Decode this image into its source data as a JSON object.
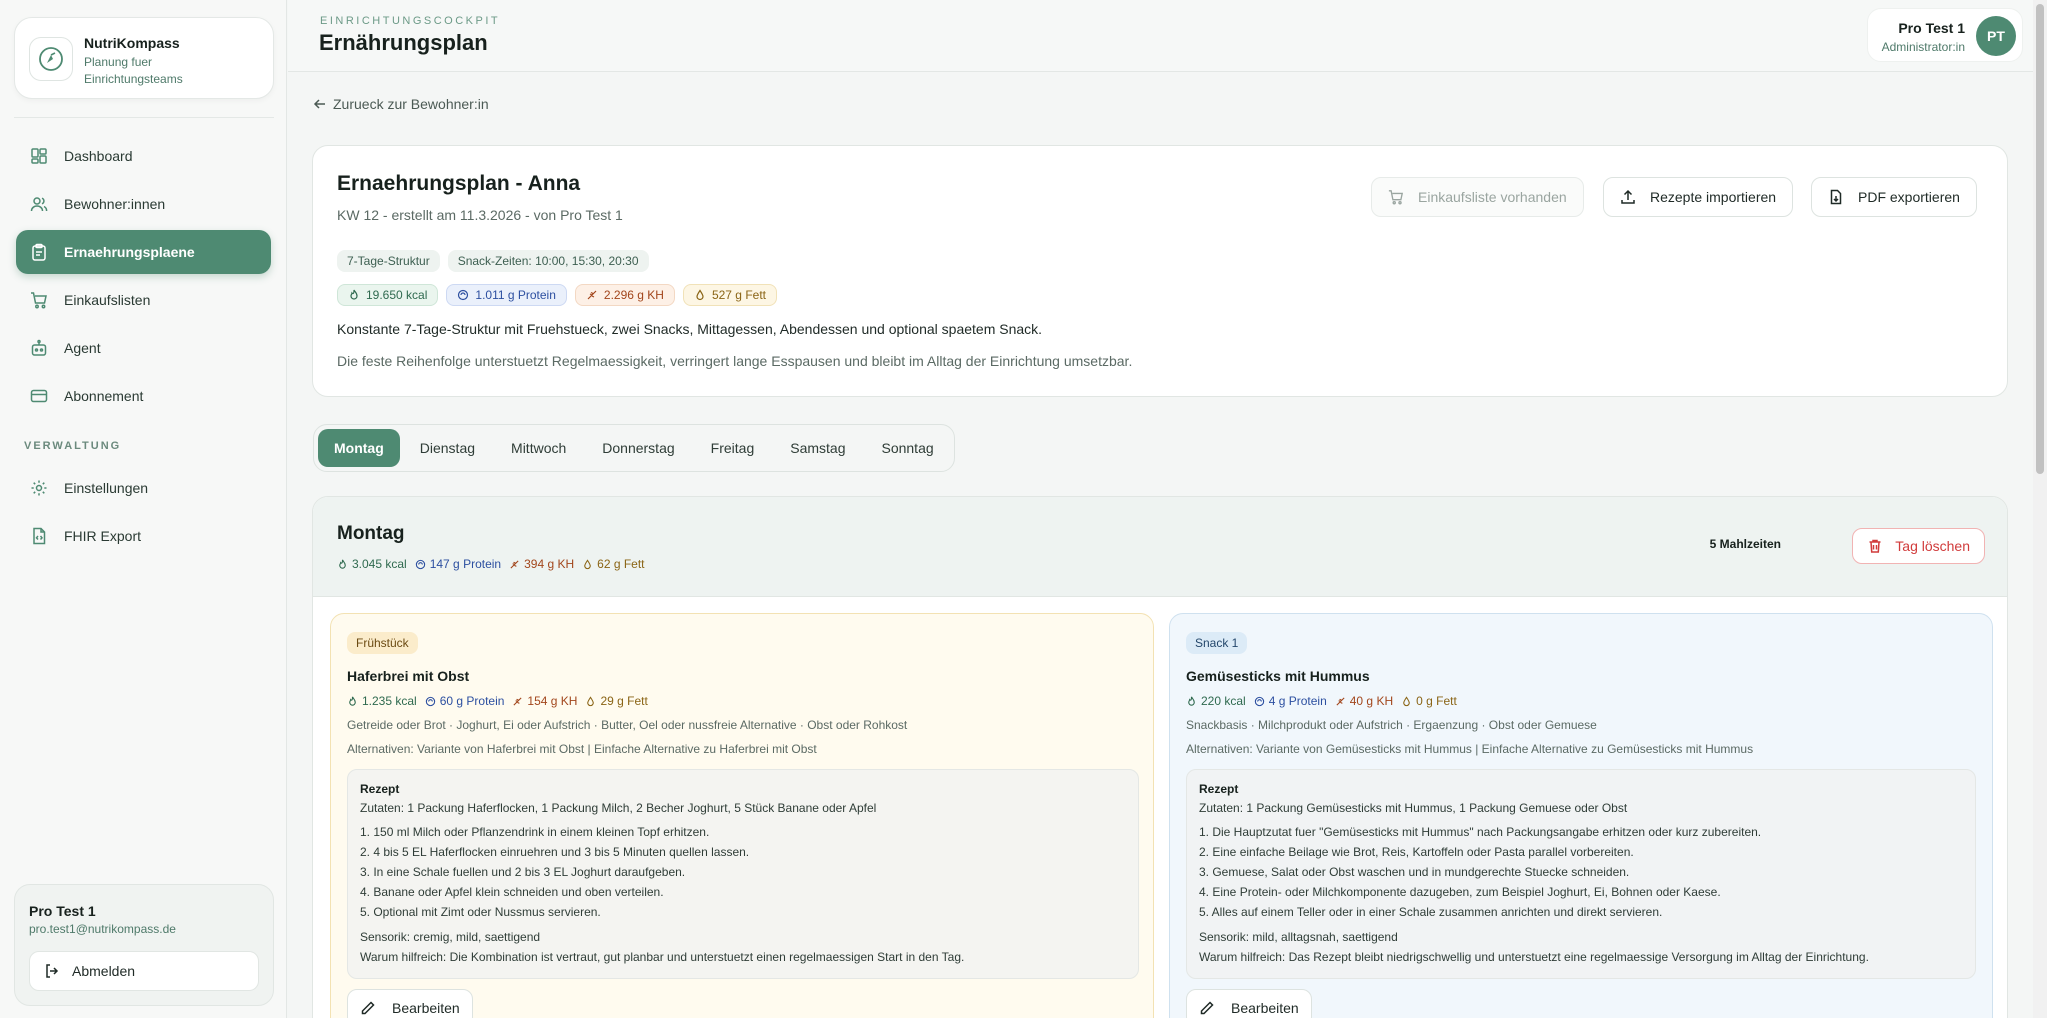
{
  "brand": {
    "name": "NutriKompass",
    "subtitle": "Planung fuer Einrichtungsteams"
  },
  "sidebar": {
    "items": [
      {
        "label": "Dashboard",
        "icon": "dashboard-icon"
      },
      {
        "label": "Bewohner:innen",
        "icon": "users-icon"
      },
      {
        "label": "Ernaehrungsplaene",
        "icon": "clipboard-icon",
        "active": true
      },
      {
        "label": "Einkaufslisten",
        "icon": "cart-icon"
      },
      {
        "label": "Agent",
        "icon": "bot-icon"
      },
      {
        "label": "Abonnement",
        "icon": "card-icon"
      }
    ],
    "section_label": "VERWALTUNG",
    "admin_items": [
      {
        "label": "Einstellungen",
        "icon": "gear-icon"
      },
      {
        "label": "FHIR Export",
        "icon": "file-code-icon"
      }
    ],
    "user": {
      "name": "Pro Test 1",
      "email": "pro.test1@nutrikompass.de",
      "logout_label": "Abmelden"
    }
  },
  "header": {
    "eyebrow": "EINRICHTUNGSCOCKPIT",
    "title": "Ernährungsplan",
    "profile": {
      "name": "Pro Test 1",
      "role": "Administrator:in",
      "initials": "PT"
    }
  },
  "back_link": "Zurueck zur Bewohner:in",
  "plan": {
    "title": "Ernaehrungsplan - Anna",
    "meta": "KW 12 - erstellt am 11.3.2026 - von Pro Test 1",
    "tags": [
      "7-Tage-Struktur",
      "Snack-Zeiten: 10:00, 15:30, 20:30"
    ],
    "macros": {
      "kcal": "19.650 kcal",
      "protein": "1.011 g Protein",
      "kh": "2.296 g KH",
      "fett": "527 g Fett"
    },
    "description": "Konstante 7-Tage-Struktur mit Fruehstueck, zwei Snacks, Mittagessen, Abendessen und optional spaetem Snack.",
    "description2": "Die feste Reihenfolge unterstuetzt Regelmaessigkeit, verringert lange Esspausen und bleibt im Alltag der Einrichtung umsetzbar.",
    "buttons": {
      "shopping": "Einkaufsliste vorhanden",
      "import": "Rezepte importieren",
      "pdf": "PDF exportieren"
    }
  },
  "tabs": [
    "Montag",
    "Dienstag",
    "Mittwoch",
    "Donnerstag",
    "Freitag",
    "Samstag",
    "Sonntag"
  ],
  "active_tab": "Montag",
  "day": {
    "title": "Montag",
    "macros": {
      "kcal": "3.045 kcal",
      "protein": "147 g Protein",
      "kh": "394 g KH",
      "fett": "62 g Fett"
    },
    "meal_count": "5 Mahlzeiten",
    "delete_label": "Tag löschen"
  },
  "meals": [
    {
      "tag": "Frühstück",
      "name": "Haferbrei mit Obst",
      "macros": {
        "kcal": "1.235 kcal",
        "protein": "60 g Protein",
        "kh": "154 g KH",
        "fett": "29 g Fett"
      },
      "components": "Getreide oder Brot · Joghurt, Ei oder Aufstrich · Butter, Oel oder nussfreie Alternative · Obst oder Rohkost",
      "alternatives": "Alternativen: Variante von Haferbrei mit Obst | Einfache Alternative zu Haferbrei mit Obst",
      "recipe_title": "Rezept",
      "ingredients": "Zutaten: 1 Packung Haferflocken, 1 Packung Milch, 2 Becher Joghurt, 5 Stück Banane oder Apfel",
      "steps": [
        "1. 150 ml Milch oder Pflanzendrink in einem kleinen Topf erhitzen.",
        "2. 4 bis 5 EL Haferflocken einruehren und 3 bis 5 Minuten quellen lassen.",
        "3. In eine Schale fuellen und 2 bis 3 EL Joghurt daraufgeben.",
        "4. Banane oder Apfel klein schneiden und oben verteilen.",
        "5. Optional mit Zimt oder Nussmus servieren."
      ],
      "sensory": "Sensorik: cremig, mild, saettigend",
      "why": "Warum hilfreich: Die Kombination ist vertraut, gut planbar und unterstuetzt einen regelmaessigen Start in den Tag.",
      "edit_label": "Bearbeiten"
    },
    {
      "tag": "Snack 1",
      "name": "Gemüsesticks mit Hummus",
      "macros": {
        "kcal": "220 kcal",
        "protein": "4 g Protein",
        "kh": "40 g KH",
        "fett": "0 g Fett"
      },
      "components": "Snackbasis · Milchprodukt oder Aufstrich · Ergaenzung · Obst oder Gemuese",
      "alternatives": "Alternativen: Variante von Gemüsesticks mit Hummus | Einfache Alternative zu Gemüsesticks mit Hummus",
      "recipe_title": "Rezept",
      "ingredients": "Zutaten: 1 Packung Gemüsesticks mit Hummus, 1 Packung Gemuese oder Obst",
      "steps": [
        "1. Die Hauptzutat fuer \"Gemüsesticks mit Hummus\" nach Packungsangabe erhitzen oder kurz zubereiten.",
        "2. Eine einfache Beilage wie Brot, Reis, Kartoffeln oder Pasta parallel vorbereiten.",
        "3. Gemuese, Salat oder Obst waschen und in mundgerechte Stuecke schneiden.",
        "4. Eine Protein- oder Milchkomponente dazugeben, zum Beispiel Joghurt, Ei, Bohnen oder Kaese.",
        "5. Alles auf einem Teller oder in einer Schale zusammen anrichten und direkt servieren."
      ],
      "sensory": "Sensorik: mild, alltagsnah, saettigend",
      "why": "Warum hilfreich: Das Rezept bleibt niedrigschwellig und unterstuetzt eine regelmaessige Versorgung im Alltag der Einrichtung.",
      "edit_label": "Bearbeiten"
    }
  ]
}
